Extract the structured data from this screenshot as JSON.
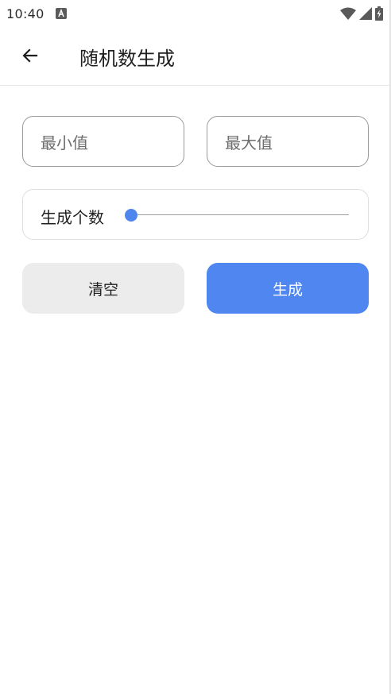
{
  "status_bar": {
    "time": "10:40",
    "icons": [
      "a-notification-icon",
      "wifi-icon",
      "cell-signal-icon",
      "battery-charging-icon"
    ]
  },
  "app_bar": {
    "title": "随机数生成",
    "back_icon": "arrow-left-icon"
  },
  "inputs": {
    "min": {
      "value": "",
      "placeholder": "最小值"
    },
    "max": {
      "value": "",
      "placeholder": "最大值"
    }
  },
  "count_slider": {
    "label": "生成个数",
    "level_fraction": 0.0
  },
  "buttons": {
    "clear_label": "清空",
    "generate_label": "生成"
  },
  "colors": {
    "accent": "#4F86EF",
    "secondary_button": "#ECECEC",
    "outline": "#9A9A9A"
  }
}
